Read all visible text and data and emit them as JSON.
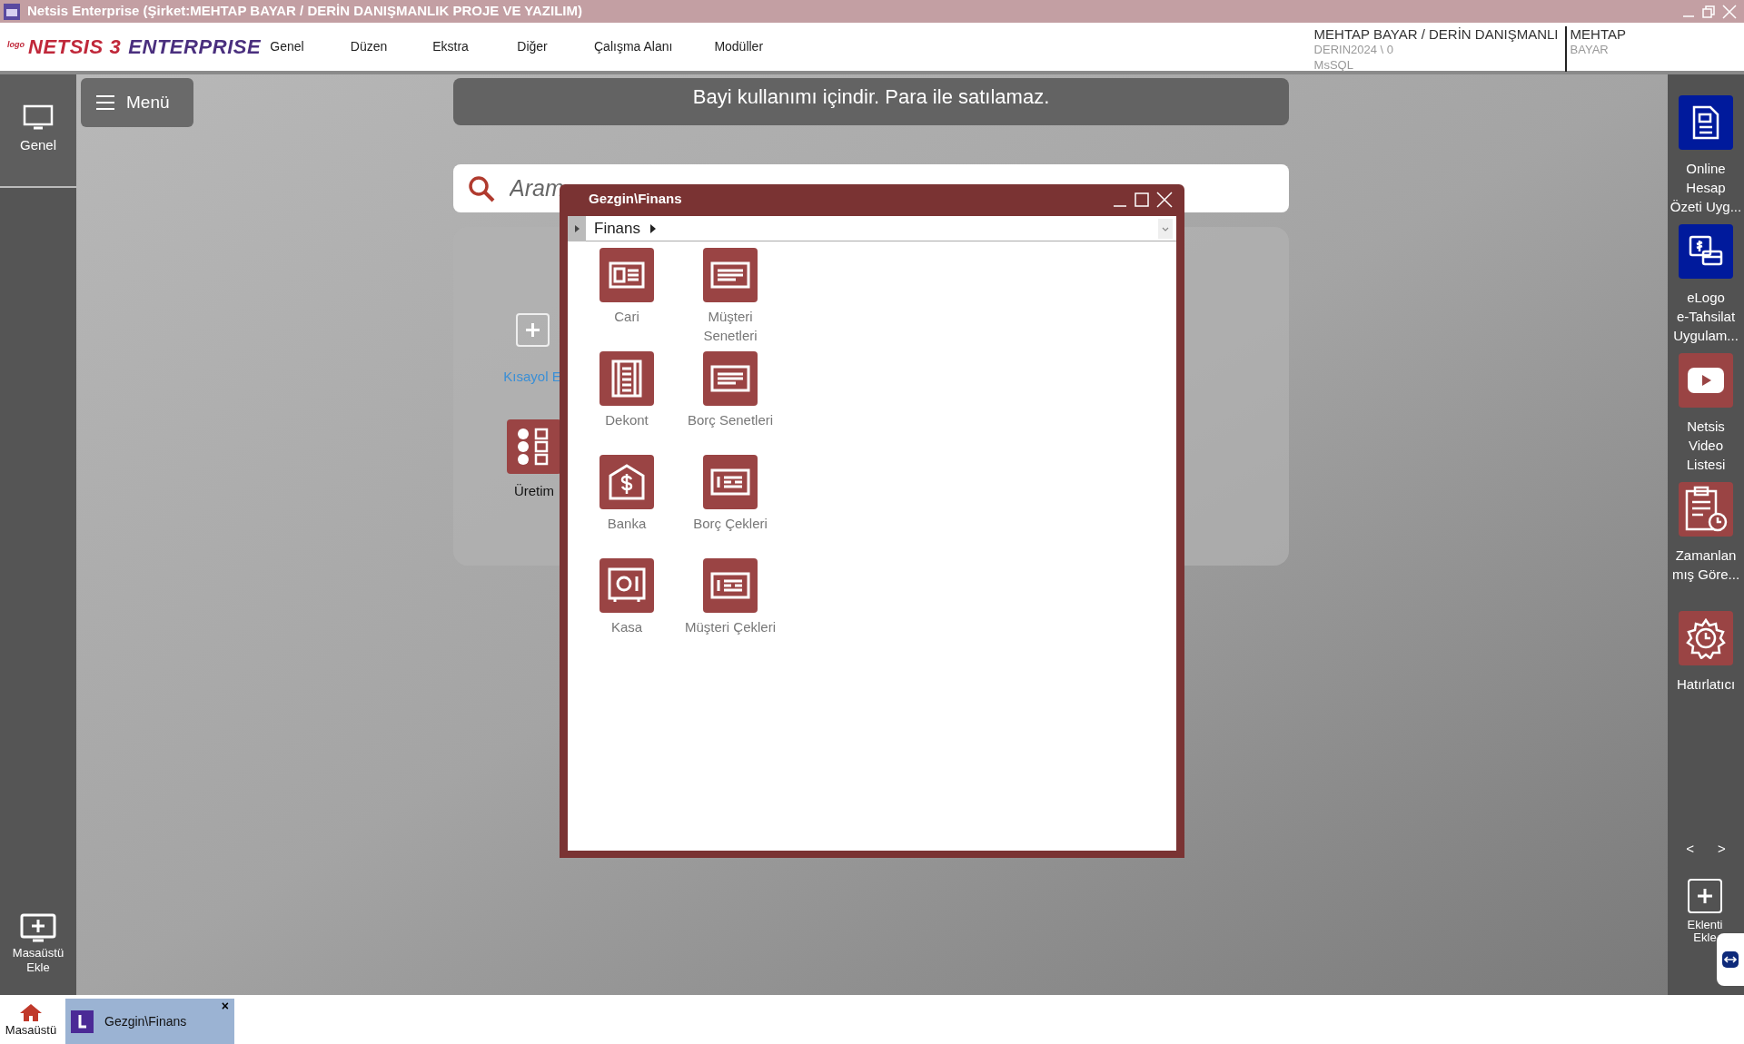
{
  "window": {
    "title": "Netsis Enterprise (Şirket:MEHTAP BAYAR / DERİN DANIŞMANLIK PROJE VE YAZILIM)"
  },
  "logo": {
    "small": "logo",
    "brand": "NETSIS 3",
    "product": "ENTERPRISE"
  },
  "menu": [
    "Genel",
    "Düzen",
    "Ekstra",
    "Diğer",
    "Çalışma Alanı",
    "Modüller"
  ],
  "user_info": {
    "company": "MEHTAP BAYAR / DERİN DANIŞMANLI",
    "database": "DERIN2024 \\ 0",
    "server": "MsSQL",
    "first_name": "MEHTAP",
    "last_name": "BAYAR"
  },
  "left_sidebar": {
    "items": [
      {
        "label": "Genel",
        "selected": true
      }
    ],
    "add_desktop": "Masaüstü\nEkle"
  },
  "menu_button": "Menü",
  "banner": "Bayi kullanımı içindir. Para ile satılamaz.",
  "search": {
    "placeholder": "Aram"
  },
  "shortcuts": [
    {
      "kind": "add",
      "label": "Kısayol E"
    },
    {
      "kind": "module",
      "label": "Üretim"
    }
  ],
  "dialog": {
    "title": "Gezgin\\Finans",
    "breadcrumb": "Finans",
    "items": [
      {
        "kind": "card",
        "label": "Cari"
      },
      {
        "kind": "note",
        "label": "Müşteri\nSenetleri"
      },
      {
        "kind": "ledger",
        "label": "Dekont"
      },
      {
        "kind": "note",
        "label": "Borç Senetleri"
      },
      {
        "kind": "bank",
        "label": "Banka"
      },
      {
        "kind": "cheque",
        "label": "Borç Çekleri"
      },
      {
        "kind": "safe",
        "label": "Kasa"
      },
      {
        "kind": "cheque",
        "label": "Müşteri Çekleri"
      }
    ]
  },
  "right_sidebar": {
    "items": [
      {
        "kind": "statement",
        "color": "#001a9c",
        "label": "Online\nHesap\nÖzeti Uyg..."
      },
      {
        "kind": "payment",
        "color": "#001a9c",
        "label": "eLogo\ne-Tahsilat\nUygulam..."
      },
      {
        "kind": "video",
        "color": "#9a4444",
        "label": "Netsis\nVideo\nListesi"
      },
      {
        "kind": "schedule",
        "color": "#9a4444",
        "label": "Zamanlan\nmış Göre..."
      },
      {
        "kind": "reminder",
        "color": "#9a4444",
        "label": "Hatırlatıcı"
      }
    ],
    "prev": "<",
    "next": ">",
    "add_plugin": "Eklenti\nEkle"
  },
  "taskbar": {
    "home": "Masaüstü",
    "tabs": [
      {
        "label": "Gezgin\\Finans",
        "selected": true,
        "close": "×"
      }
    ]
  }
}
